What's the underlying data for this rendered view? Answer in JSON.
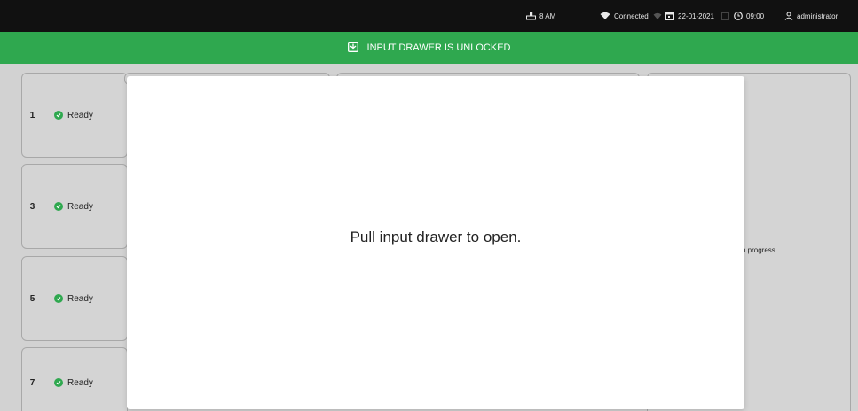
{
  "status_bar": {
    "storage": "8 AM",
    "network": "Connected",
    "date": "22-01-2021",
    "time": "09:00",
    "user": "administrator"
  },
  "banner": {
    "text": "INPUT DRAWER IS UNLOCKED",
    "color": "#2fa84f"
  },
  "slots": [
    {
      "number": "1",
      "status": "Ready"
    },
    {
      "number": "3",
      "status": "Ready"
    },
    {
      "number": "5",
      "status": "Ready"
    },
    {
      "number": "7",
      "status": "Ready"
    }
  ],
  "background_fragment": "n progress",
  "modal": {
    "message": "Pull input drawer to open."
  }
}
